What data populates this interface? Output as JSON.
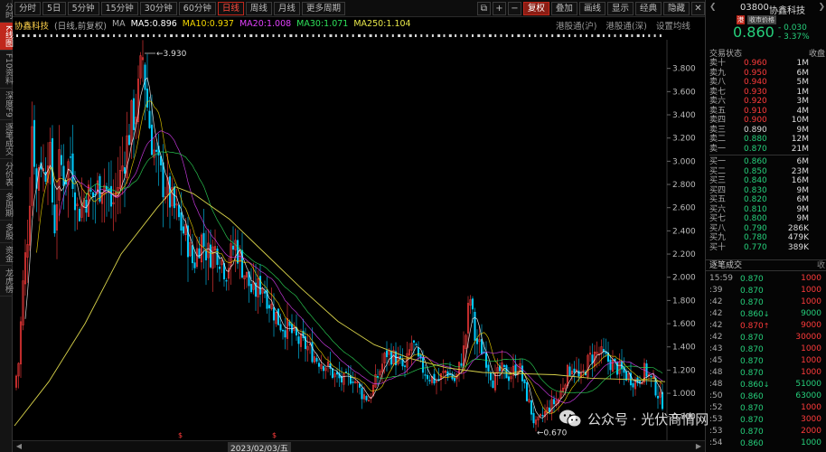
{
  "left_nav": [
    {
      "label": "分时"
    },
    {
      "label": "K线图",
      "active": true
    },
    {
      "label": "F10资料"
    },
    {
      "label": "深度F9"
    },
    {
      "label": "逐笔成交"
    },
    {
      "label": "分价表"
    },
    {
      "label": "多周期"
    },
    {
      "label": "多股"
    },
    {
      "label": "资金"
    },
    {
      "label": "龙虎榜"
    }
  ],
  "toolbar": {
    "periods": [
      "分时",
      "5日",
      "5分钟",
      "15分钟",
      "30分钟",
      "60分钟",
      "日线",
      "周线",
      "月线",
      "更多周期"
    ],
    "active_period": "日线",
    "right_buttons": [
      {
        "label": "复权",
        "red": true
      },
      {
        "label": "叠加"
      },
      {
        "label": "画线"
      },
      {
        "label": "显示"
      },
      {
        "label": "经典"
      },
      {
        "label": "隐藏"
      }
    ],
    "icons": [
      "⧉",
      "+",
      "−"
    ],
    "close_icon": "✕"
  },
  "ma_legend": {
    "stock": "协鑫科技",
    "adjust": "(日线,前复权)",
    "ma_label": "MA",
    "ma5": "MA5:0.896",
    "ma10": "MA10:0.937",
    "ma20": "MA20:1.008",
    "ma30": "MA30:1.071",
    "ma250": "MA250:1.104",
    "colors": {
      "ma5": "#ffffff",
      "ma10": "#f5d800",
      "ma20": "#e040fb",
      "ma30": "#2ee05a",
      "ma250": "#e8e84a"
    }
  },
  "sub_links": [
    "港股通(沪)",
    "港股通(深)",
    "设置均线"
  ],
  "chart_data": {
    "type": "candlestick",
    "y_ticks": [
      "3.800",
      "3.600",
      "3.400",
      "3.200",
      "3.000",
      "2.800",
      "2.600",
      "2.400",
      "2.200",
      "2.000",
      "1.800",
      "1.600",
      "1.400",
      "1.200",
      "1.000",
      "0.800"
    ],
    "ylim": [
      0.65,
      4.0
    ],
    "annotations": [
      {
        "label": "3.930",
        "kind": "high"
      },
      {
        "label": "0.670",
        "kind": "low"
      }
    ],
    "date_label": "2023/02/03/五",
    "event_marker": "$",
    "colors": {
      "up": "#ff3b3b",
      "down": "#00ccff",
      "ma_long": "#d9d34a"
    }
  },
  "quote": {
    "code": "03800",
    "name": "协鑫科技",
    "tag_market": "港",
    "tag_status": "收市价格",
    "price": "0.860",
    "change": "- 0.030",
    "change_pct": "- 3.37%",
    "status_label": "交易状态",
    "status_value": "收盘"
  },
  "orderbook": {
    "asks": [
      {
        "label": "卖十",
        "price": "0.960",
        "vol": "1M",
        "color": "red"
      },
      {
        "label": "卖九",
        "price": "0.950",
        "vol": "6M",
        "color": "red"
      },
      {
        "label": "卖八",
        "price": "0.940",
        "vol": "5M",
        "color": "red"
      },
      {
        "label": "卖七",
        "price": "0.930",
        "vol": "1M",
        "color": "red"
      },
      {
        "label": "卖六",
        "price": "0.920",
        "vol": "3M",
        "color": "red"
      },
      {
        "label": "卖五",
        "price": "0.910",
        "vol": "4M",
        "color": "red"
      },
      {
        "label": "卖四",
        "price": "0.900",
        "vol": "10M",
        "color": "red"
      },
      {
        "label": "卖三",
        "price": "0.890",
        "vol": "9M",
        "color": "white"
      },
      {
        "label": "卖二",
        "price": "0.880",
        "vol": "12M",
        "color": "green"
      },
      {
        "label": "卖一",
        "price": "0.870",
        "vol": "21M",
        "color": "green"
      }
    ],
    "bids": [
      {
        "label": "买一",
        "price": "0.860",
        "vol": "6M",
        "color": "green"
      },
      {
        "label": "买二",
        "price": "0.850",
        "vol": "23M",
        "color": "green"
      },
      {
        "label": "买三",
        "price": "0.840",
        "vol": "16M",
        "color": "green"
      },
      {
        "label": "买四",
        "price": "0.830",
        "vol": "9M",
        "color": "green"
      },
      {
        "label": "买五",
        "price": "0.820",
        "vol": "6M",
        "color": "green"
      },
      {
        "label": "买六",
        "price": "0.810",
        "vol": "9M",
        "color": "green"
      },
      {
        "label": "买七",
        "price": "0.800",
        "vol": "9M",
        "color": "green"
      },
      {
        "label": "买八",
        "price": "0.790",
        "vol": "286K",
        "color": "green"
      },
      {
        "label": "买九",
        "price": "0.780",
        "vol": "479K",
        "color": "green"
      },
      {
        "label": "买十",
        "price": "0.770",
        "vol": "389K",
        "color": "green"
      }
    ]
  },
  "ticks_header": {
    "label": "逐笔成交",
    "right": "收"
  },
  "ticks": [
    {
      "time": "15:59",
      "price": "0.870",
      "price_color": "green",
      "vol": "1000",
      "vol_color": "red",
      "arrow": ""
    },
    {
      "time": ":39",
      "price": "0.870",
      "price_color": "green",
      "vol": "1000",
      "vol_color": "red",
      "arrow": ""
    },
    {
      "time": ":42",
      "price": "0.870",
      "price_color": "green",
      "vol": "1000",
      "vol_color": "red",
      "arrow": ""
    },
    {
      "time": ":42",
      "price": "0.860",
      "price_color": "green",
      "vol": "9000",
      "vol_color": "green",
      "arrow": "↓"
    },
    {
      "time": ":42",
      "price": "0.870",
      "price_color": "red",
      "vol": "9000",
      "vol_color": "red",
      "arrow": "↑"
    },
    {
      "time": ":42",
      "price": "0.870",
      "price_color": "green",
      "vol": "30000",
      "vol_color": "red",
      "arrow": ""
    },
    {
      "time": ":43",
      "price": "0.870",
      "price_color": "green",
      "vol": "1000",
      "vol_color": "red",
      "arrow": ""
    },
    {
      "time": ":45",
      "price": "0.870",
      "price_color": "green",
      "vol": "1000",
      "vol_color": "red",
      "arrow": ""
    },
    {
      "time": ":48",
      "price": "0.870",
      "price_color": "green",
      "vol": "1000",
      "vol_color": "red",
      "arrow": ""
    },
    {
      "time": ":48",
      "price": "0.860",
      "price_color": "green",
      "vol": "51000",
      "vol_color": "green",
      "arrow": "↓"
    },
    {
      "time": ":50",
      "price": "0.860",
      "price_color": "green",
      "vol": "63000",
      "vol_color": "green",
      "arrow": ""
    },
    {
      "time": ":52",
      "price": "0.870",
      "price_color": "green",
      "vol": "1000",
      "vol_color": "red",
      "arrow": ""
    },
    {
      "time": ":53",
      "price": "0.870",
      "price_color": "green",
      "vol": "3000",
      "vol_color": "red",
      "arrow": ""
    },
    {
      "time": ":53",
      "price": "0.870",
      "price_color": "green",
      "vol": "2000",
      "vol_color": "red",
      "arrow": ""
    },
    {
      "time": ":54",
      "price": "0.860",
      "price_color": "green",
      "vol": "1000",
      "vol_color": "green",
      "arrow": ""
    }
  ],
  "watermark": {
    "text": "公众号 · 光伏商情网"
  }
}
